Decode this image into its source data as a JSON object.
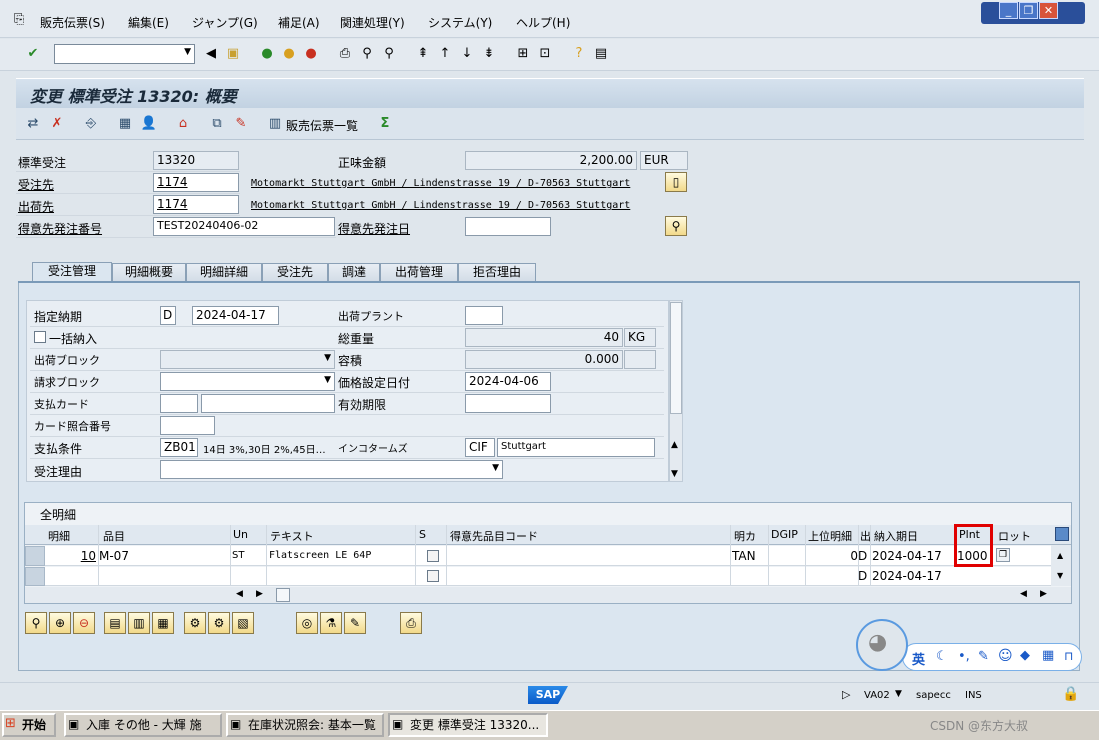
{
  "menu": {
    "items": [
      "販売伝票(S)",
      "編集(E)",
      "ジャンプ(G)",
      "補足(A)",
      "関連処理(Y)",
      "システム(Y)",
      "ヘルプ(H)"
    ]
  },
  "window": {
    "min": "_",
    "max": "❐",
    "close": "✕"
  },
  "toolbar": {
    "command_value": ""
  },
  "title": "変更 標準受注 13320: 概要",
  "app_toolbar": {
    "doc_flow_label": "販売伝票一覧"
  },
  "header": {
    "order_type_label": "標準受注",
    "order_number": "13320",
    "net_value_label": "正味金額",
    "net_value": "2,200.00",
    "currency": "EUR",
    "sold_to_label": "受注先",
    "sold_to": "1174",
    "sold_to_addr": "Motomarkt Stuttgart GmbH / Lindenstrasse 19 / D-70563 Stuttgart",
    "ship_to_label": "出荷先",
    "ship_to": "1174",
    "ship_to_addr": "Motomarkt Stuttgart GmbH / Lindenstrasse 19 / D-70563 Stuttgart",
    "po_number_label": "得意先発注番号",
    "po_number": "TEST20240406-02",
    "po_date_label": "得意先発注日",
    "po_date": ""
  },
  "tabs": [
    "受注管理",
    "明細概要",
    "明細詳細",
    "受注先",
    "調達",
    "出荷管理",
    "拒否理由"
  ],
  "sales": {
    "req_deliv_label": "指定納期",
    "req_deliv_unit": "D",
    "req_deliv_date": "2024-04-17",
    "plant_label": "出荷プラント",
    "plant_value": "",
    "complete_label": "一括納入",
    "weight_label": "総重量",
    "weight_value": "40",
    "weight_unit": "KG",
    "block_label": "出荷ブロック",
    "volume_label": "容積",
    "volume_value": "0.000",
    "billing_block_label": "請求ブロック",
    "pricing_date_label": "価格設定日付",
    "pricing_date": "2024-04-06",
    "card_label": "支払カード",
    "valid_label": "有効期限",
    "card_verif_label": "カード照合番号",
    "terms_label": "支払条件",
    "terms_code": "ZB01",
    "terms_text": "14日 3%,30日 2%,45日…",
    "incoterms_label": "インコタームズ",
    "incoterms_code": "CIF",
    "incoterms_place": "Stuttgart",
    "reason_label": "受注理由"
  },
  "items": {
    "title": "全明細",
    "columns": [
      "明細",
      "品目",
      "Un",
      "テキスト",
      "S",
      "得意先品目コード",
      "明カ",
      "DGIP",
      "上位明細",
      "出",
      "納入期日",
      "Plnt",
      "ロット"
    ],
    "rows": [
      {
        "item": "10",
        "material": "M-07",
        "unit": "ST",
        "text": "Flatscreen LE 64P",
        "cat": "TAN",
        "higher": "0",
        "dunit": "D",
        "date": "2024-04-17",
        "plant": "1000"
      },
      {
        "item": "",
        "material": "",
        "unit": "",
        "text": "",
        "cat": "",
        "higher": "",
        "dunit": "D",
        "date": "2024-04-17",
        "plant": ""
      }
    ]
  },
  "status": {
    "tcode": "VA02",
    "server": "sapecc",
    "mode": "INS",
    "sap": "SAP"
  },
  "ime": {
    "lang": "英"
  },
  "taskbar": {
    "start": "开始",
    "tasks": [
      "入庫 その他 - 大輝 施",
      "在庫状況照会: 基本一覧",
      "変更 標準受注 13320..."
    ],
    "watermark": "CSDN @东方大叔"
  }
}
